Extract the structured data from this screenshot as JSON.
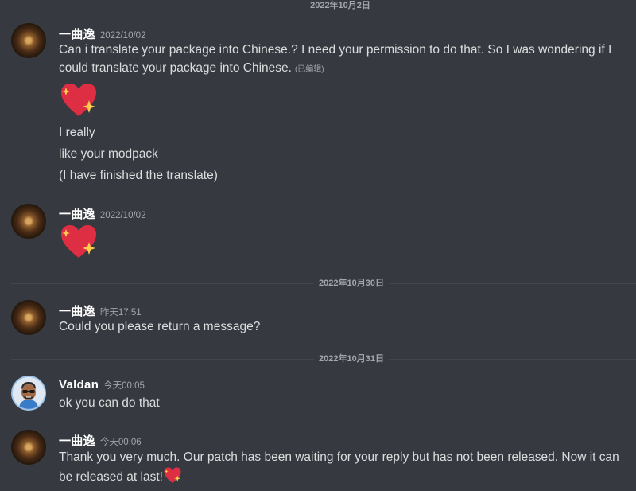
{
  "dividers": [
    "2022年10月2日",
    "2022年10月30日",
    "2022年10月31日"
  ],
  "messages": [
    {
      "author": "一曲逸",
      "timestamp": "2022/10/02",
      "lines": [
        "Can i translate your package into Chinese.?  I need your permission to do that. So I was wondering if I",
        "could translate your package into Chinese."
      ],
      "edited": "(已编辑)",
      "lines2": [
        "I really",
        "like your modpack",
        "(I have finished the translate)"
      ],
      "emoji": "sparkling-heart-icon"
    },
    {
      "author": "一曲逸",
      "timestamp": "2022/10/02",
      "emoji": "sparkling-heart-icon"
    },
    {
      "author": "一曲逸",
      "timestamp": "昨天17:51",
      "lines": [
        "Could you please return a message?"
      ]
    },
    {
      "author": "Valdan",
      "timestamp": "今天00:05",
      "lines": [
        "ok you can do that"
      ]
    },
    {
      "author": "一曲逸",
      "timestamp": "今天00:06",
      "lines": [
        "Thank you very much. Our patch has been waiting for your reply but has not been released. Now it can",
        "be released at last!"
      ],
      "emoji": "sparkling-heart-icon"
    }
  ],
  "colors": {
    "background": "#36393f",
    "text": "#dcddde",
    "username": "#ffffff",
    "timestamp": "#a3a6aa",
    "divider": "#42454a",
    "heart": "#dd2e44",
    "sparkle": "#ffcc4d"
  }
}
